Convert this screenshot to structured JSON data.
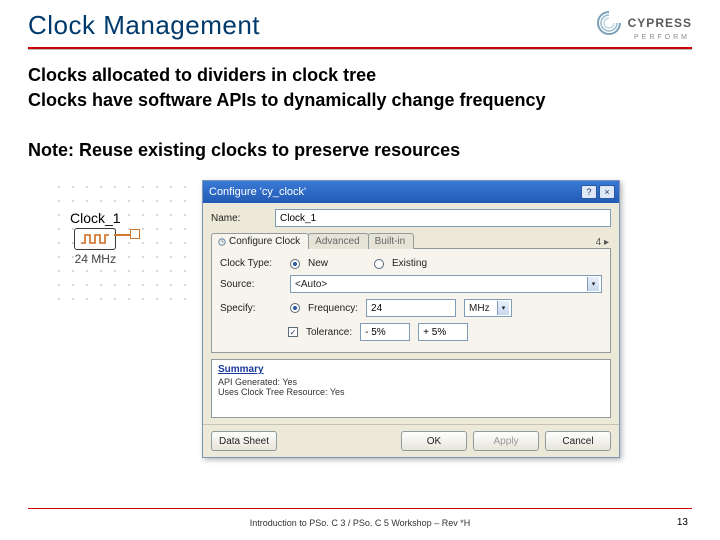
{
  "header": {
    "title": "Clock Management",
    "logo_text": "CYPRESS",
    "logo_sub": "PERFORM"
  },
  "content": {
    "b1": "Clocks allocated to dividers in clock tree",
    "b2": "Clocks have software APIs to dynamically change frequency",
    "note": "Note: Reuse existing clocks to preserve resources"
  },
  "schematic": {
    "label": "Clock_1",
    "freq": "24 MHz"
  },
  "dialog": {
    "title": "Configure 'cy_clock'",
    "btn_help": "?",
    "btn_close": "×",
    "name_label": "Name:",
    "name_value": "Clock_1",
    "tabs": {
      "configure": "Configure Clock",
      "advanced": "Advanced",
      "builtin": "Built-in"
    },
    "res_count": "4 ▸",
    "clock_type_label": "Clock Type:",
    "clock_type_new": "New",
    "clock_type_existing": "Existing",
    "source_label": "Source:",
    "source_value": "<Auto>",
    "specify_label": "Specify:",
    "specify_freq_label": "Frequency:",
    "specify_freq_val": "24",
    "specify_freq_unit": "MHz",
    "tol_label": "Tolerance:",
    "tol_minus": "- 5%",
    "tol_plus": "+ 5%",
    "summary_h": "Summary",
    "summary_l1": "API Generated: Yes",
    "summary_l2": "Uses Clock Tree Resource: Yes",
    "buttons": {
      "datasheet": "Data Sheet",
      "ok": "OK",
      "apply": "Apply",
      "cancel": "Cancel"
    }
  },
  "footer": {
    "text": "Introduction to PSo. C 3 / PSo. C 5 Workshop – Rev *H",
    "page": "13"
  }
}
